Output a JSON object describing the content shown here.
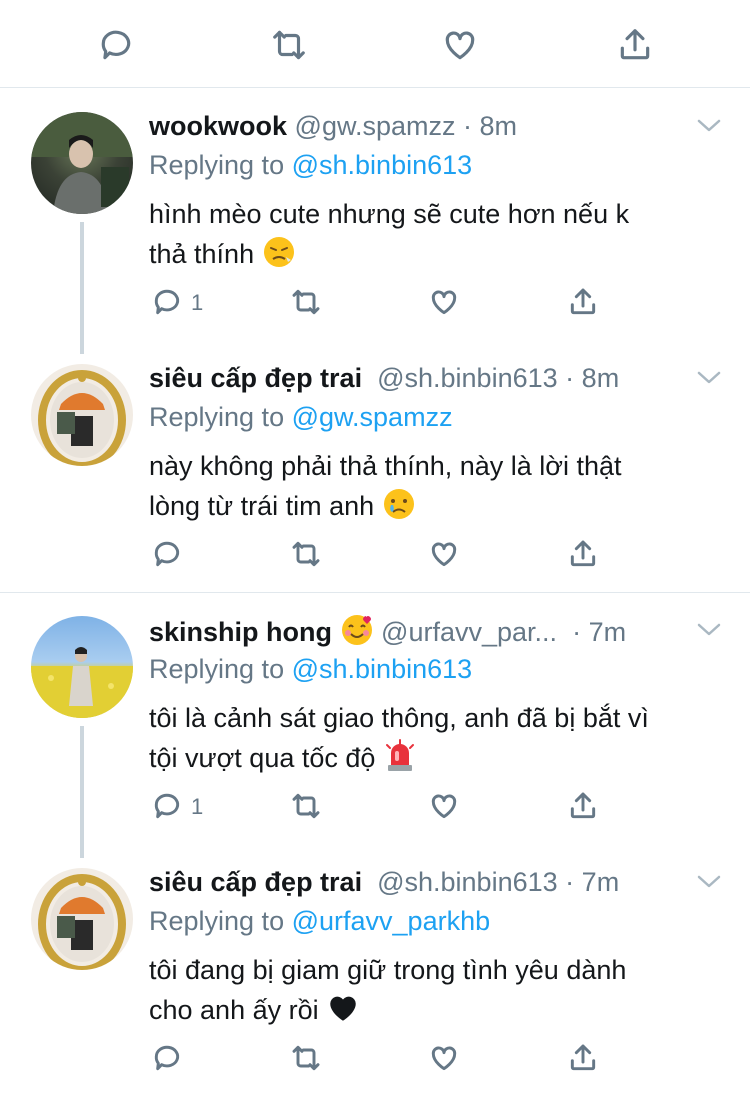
{
  "top_actions": [
    "reply-icon",
    "retweet-icon",
    "like-icon",
    "share-icon"
  ],
  "tweets": [
    {
      "name": "wookwook",
      "handle": "@gw.spamzz",
      "dot": "·",
      "time": "8m",
      "replying_label": "Replying to",
      "replying_to": "@sh.binbin613",
      "text_line1": "hình mèo cute nhưng sẽ cute hơn nếu k",
      "text_line2": "thả thính",
      "emoji": "persevering-face-emoji",
      "reply_count": "1"
    },
    {
      "name": "siêu cấp đẹp trai",
      "handle": "@sh.binbin613",
      "dot": "·",
      "time": "8m",
      "replying_label": "Replying to",
      "replying_to": "@gw.spamzz",
      "text_line1": "này không phải thả thính, này là lời thật",
      "text_line2": "lòng từ trái tim anh",
      "emoji": "crying-face-emoji",
      "reply_count": ""
    },
    {
      "name": "skinship hong",
      "handle": "@urfavv_par...",
      "dot": "·",
      "time": "7m",
      "replying_label": "Replying to",
      "replying_to": "@sh.binbin613",
      "text_line1": "tôi là cảnh sát giao thông, anh đã bị bắt vì",
      "text_line2": "tội vượt qua tốc độ",
      "emoji": "police-light-emoji",
      "reply_count": "1"
    },
    {
      "name": "siêu cấp đẹp trai",
      "handle": "@sh.binbin613",
      "dot": "·",
      "time": "7m",
      "replying_label": "Replying to",
      "replying_to": "@urfavv_parkhb",
      "text_line1": "tôi đang bị giam giữ trong tình yêu dành",
      "text_line2": "cho anh ấy rồi",
      "emoji": "black-heart-emoji",
      "reply_count": ""
    }
  ],
  "colors": {
    "link": "#1da1f2",
    "secondary": "#657786",
    "divider": "#e1e8ed",
    "thread_line": "#ccd6dd"
  }
}
